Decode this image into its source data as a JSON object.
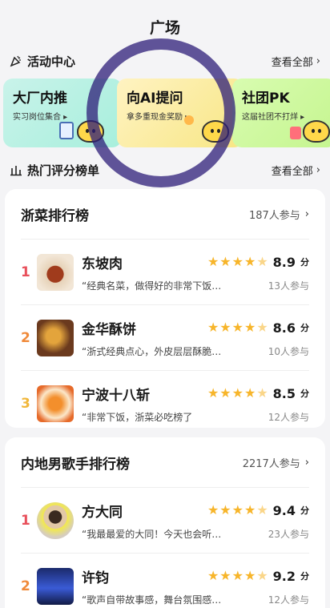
{
  "header": {
    "title": "广场"
  },
  "activity": {
    "title": "活动中心",
    "more": "查看全部",
    "banners": [
      {
        "title": "大厂内推",
        "subtitle": "实习岗位集合 ▸"
      },
      {
        "title": "向AI提问",
        "subtitle": "拿多重现金奖励 ▸"
      },
      {
        "title": "社团PK",
        "subtitle": "这届社团不打烊 ▸"
      }
    ]
  },
  "rankings": {
    "title": "热门评分榜单",
    "more": "查看全部"
  },
  "lists": [
    {
      "title": "浙菜排行榜",
      "participants": "187人参与",
      "items": [
        {
          "rank": "1",
          "name": "东坡肉",
          "rating": 4.5,
          "score": "8.9",
          "unit": "分",
          "quote": "“经典名菜，做得好的非常下饭…",
          "count": "13人参与"
        },
        {
          "rank": "2",
          "name": "金华酥饼",
          "rating": 4.5,
          "score": "8.6",
          "unit": "分",
          "quote": "“浙式经典点心，外皮层层酥脆…",
          "count": "10人参与"
        },
        {
          "rank": "3",
          "name": "宁波十八斩",
          "rating": 4.5,
          "score": "8.5",
          "unit": "分",
          "quote": "“非常下饭，浙菜必吃榜了",
          "count": "12人参与"
        }
      ]
    },
    {
      "title": "内地男歌手排行榜",
      "participants": "2217人参与",
      "items": [
        {
          "rank": "1",
          "name": "方大同",
          "rating": 4.5,
          "score": "9.4",
          "unit": "分",
          "quote": "“我最最爱的大同！今天也会听…",
          "count": "23人参与"
        },
        {
          "rank": "2",
          "name": "许钧",
          "rating": 4.5,
          "score": "9.2",
          "unit": "分",
          "quote": "“歌声自带故事感，舞台氛围感…",
          "count": "12人参与"
        }
      ]
    }
  ],
  "colors": {
    "star": "#f7b52a",
    "rank1": "#e8505b",
    "rank2": "#f08a3a",
    "rank3": "#f1b73b"
  },
  "icons": {
    "activity": "party-icon",
    "rankings": "bar-chart-icon",
    "more": "chevron-right-icon"
  }
}
